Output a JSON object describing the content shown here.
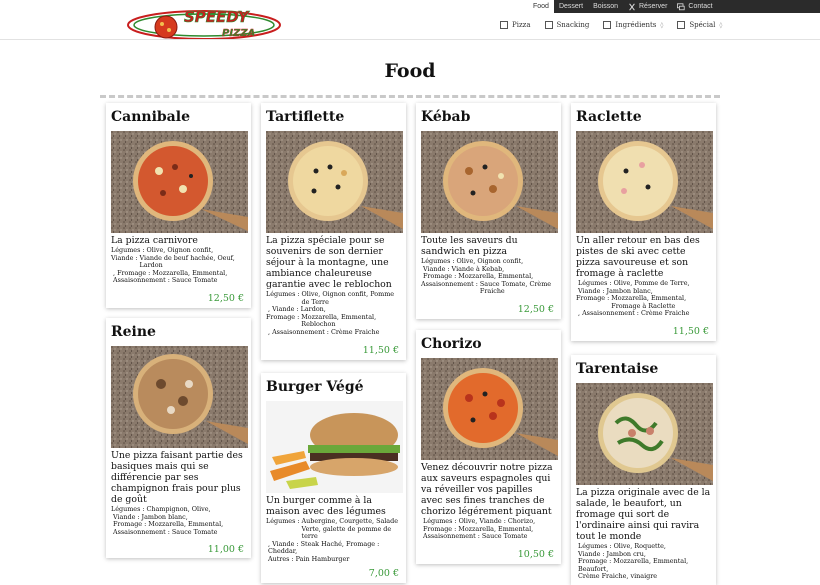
{
  "topnav": {
    "items": [
      "Food",
      "Dessert",
      "Boisson",
      "Réserver",
      "Contact"
    ],
    "active": "Food"
  },
  "logo": {
    "text_line1": "SPEEDY",
    "text_line2": "PIZZA"
  },
  "filters": {
    "pizza": "Pizza",
    "snacking": "Snacking",
    "ingredients": "Ingrédients",
    "special": "Spécial",
    "dropdown_glyph": "◊"
  },
  "page_title": "Food",
  "colors": {
    "price": "#3a9a3a",
    "topbar": "#2b2b2b"
  },
  "cards": {
    "cannibale": {
      "name": "Cannibale",
      "desc": "La pizza carnivore",
      "det": [
        {
          "k": "Légumes : ",
          "v": "Olive, Oignon confit,"
        },
        {
          "k": "Viande : ",
          "v": "Viande de beuf hachée, Oeuf, Lardon"
        },
        {
          "k": "",
          "v": ", Fromage : Mozzarella, Emmental,"
        },
        {
          "k": "",
          "v": "Assaisonnement : Sauce Tomate"
        }
      ],
      "price": "12,50 €"
    },
    "reine": {
      "name": "Reine",
      "desc": "Une pizza faisant partie des basiques mais qui se différencie par ses champignon frais pour plus de goût",
      "det": [
        {
          "k": "Légumes : ",
          "v": "Champignon, Olive,"
        },
        {
          "k": "",
          "v": "Viande : Jambon blanc,"
        },
        {
          "k": "",
          "v": "Fromage : Mozzarella, Emmental,"
        },
        {
          "k": "",
          "v": "Assaisonnement : Sauce Tomate"
        }
      ],
      "price": "11,00 €"
    },
    "tartiflette": {
      "name": "Tartiflette",
      "desc": "La pizza spéciale pour se souvenirs de son dernier séjour à la montagne, une ambiance chaleureuse garantie avec le reblochon",
      "det": [
        {
          "k": "Légumes : ",
          "v": "Olive, Oignon confit, Pomme de Terre"
        },
        {
          "k": "",
          "v": ", Viande : Lardon,"
        },
        {
          "k": "Fromage : ",
          "v": "Mozzarella, Emmental, Reblochon"
        },
        {
          "k": "",
          "v": ", Assaisonnement : Crème Fraiche"
        }
      ],
      "price": "11,50 €"
    },
    "burger": {
      "name": "Burger Végé",
      "desc": "Un burger comme à la maison avec des légumes",
      "det": [
        {
          "k": "Légumes : ",
          "v": "Aubergine, Courgette, Salade Verte, galette de pomme de terre"
        },
        {
          "k": "",
          "v": ", Viande : Steak Haché, Fromage : Cheddar,"
        },
        {
          "k": "",
          "v": "Autres : Pain Hamburger"
        }
      ],
      "price": "7,00 €"
    },
    "kebab": {
      "name": "Kébab",
      "desc": "Toute les saveurs du sandwich en pizza",
      "det": [
        {
          "k": "Légumes : ",
          "v": "Olive, Oignon confit,"
        },
        {
          "k": "",
          "v": "Viande : Viande à Kebab,"
        },
        {
          "k": "",
          "v": "Fromage : Mozzarella, Emmental,"
        },
        {
          "k": "Assaisonnement : ",
          "v": "Sauce Tomate, Crème Fraiche"
        }
      ],
      "price": "12,50 €"
    },
    "chorizo": {
      "name": "Chorizo",
      "desc": "Venez découvrir notre pizza aux saveurs espagnoles qui va réveiller vos papilles avec ses fines tranches de chorizo légérement piquant",
      "det": [
        {
          "k": "",
          "v": "Légumes : Olive, Viande : Chorizo,"
        },
        {
          "k": "",
          "v": "Fromage : Mozzarella, Emmental,"
        },
        {
          "k": "",
          "v": "Assaisonnement : Sauce Tomate"
        }
      ],
      "price": "10,50 €"
    },
    "raclette": {
      "name": "Raclette",
      "desc": "Un aller retour en bas des pistes de ski avec cette pizza savoureuse et son fromage à raclette",
      "det": [
        {
          "k": "",
          "v": "Légumes : Olive, Pomme de Terre,"
        },
        {
          "k": "",
          "v": "Viande : Jambon blanc,"
        },
        {
          "k": "Fromage : ",
          "v": "Mozzarella, Emmental, Fromage à Raclette"
        },
        {
          "k": "",
          "v": ", Assaisonnement : Crème Fraiche"
        }
      ],
      "price": "11,50 €"
    },
    "tarentaise": {
      "name": "Tarentaise",
      "desc": "La pizza originale avec de la salade, le beaufort, un fromage qui sort de l'ordinaire ainsi qui ravira tout le monde",
      "det": [
        {
          "k": "",
          "v": "Légumes : Olive, Roquette,"
        },
        {
          "k": "",
          "v": "Viande : Jambon cru,"
        },
        {
          "k": "",
          "v": "Fromage : Mozzarella, Emmental, Beaufort,"
        },
        {
          "k": "",
          "v": "Crème Fraiche, vinaigre"
        }
      ],
      "price": ""
    }
  }
}
